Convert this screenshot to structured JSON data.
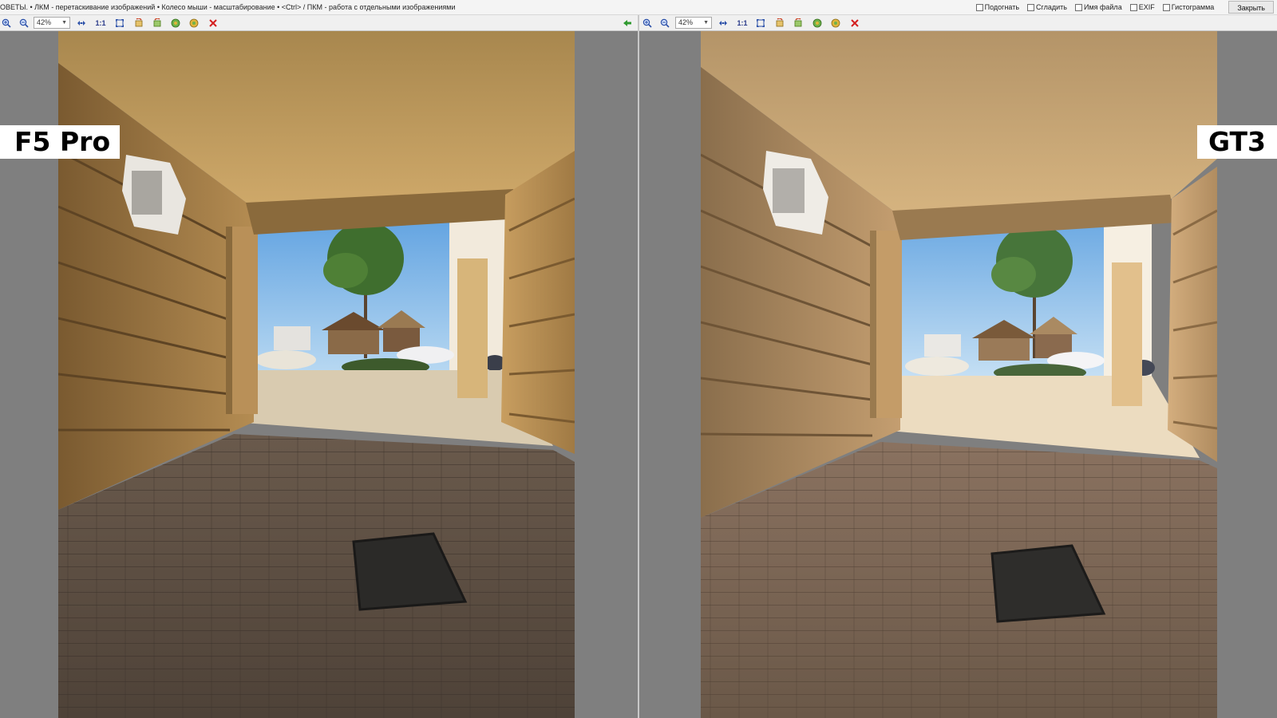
{
  "hint_text": "ОВЕТЫ.  • ЛКМ - перетаскивание изображений  • Колесо мыши - масштабирование  • <Ctrl> / ПКМ - работа с отдельными изображениями",
  "options": [
    {
      "label": "Подогнать",
      "checked": false
    },
    {
      "label": "Сгладить",
      "checked": false
    },
    {
      "label": "Имя файла",
      "checked": false
    },
    {
      "label": "EXIF",
      "checked": false
    },
    {
      "label": "Гистограмма",
      "checked": false
    }
  ],
  "close_label": "Закрыть",
  "left_panel": {
    "zoom": "42%",
    "one_to_one": "1:1",
    "icons": [
      "zoom-in-icon",
      "zoom-out-icon",
      "fit-icon",
      "fit-window-icon",
      "rotate-left-icon",
      "rotate-right-icon",
      "flip-horizontal-icon",
      "flip-vertical-icon",
      "close-icon"
    ],
    "label": "F5 Pro"
  },
  "right_panel": {
    "zoom": "42%",
    "one_to_one": "1:1",
    "icons": [
      "back-arrow-icon",
      "zoom-in-icon",
      "zoom-out-icon",
      "fit-icon",
      "fit-window-icon",
      "rotate-left-icon",
      "rotate-right-icon",
      "flip-horizontal-icon",
      "flip-vertical-icon",
      "close-icon"
    ],
    "label": "GT3"
  },
  "colors": {
    "accent_green": "#2f9a2f",
    "close_red": "#d42020"
  }
}
